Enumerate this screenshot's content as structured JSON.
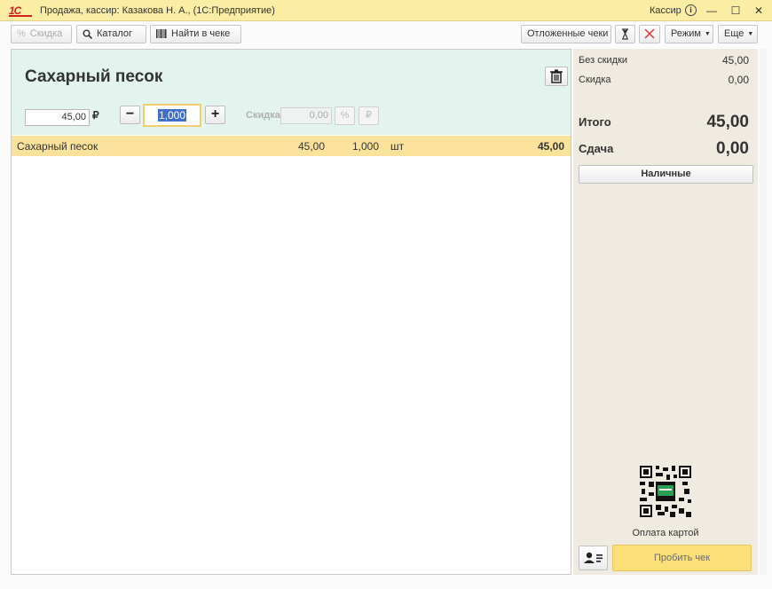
{
  "window": {
    "logo": "1С",
    "title": "Продажа, кассир: Казакова Н. А., (1С:Предприятие)",
    "user": "Кассир",
    "info_icon": "i",
    "minimize": "—",
    "maximize": "☐",
    "close": "✕"
  },
  "toolbar": {
    "discount": "Скидка",
    "catalog": "Каталог",
    "find_in_receipt": "Найти в чеке",
    "deferred_receipts": "Отложенные чеки",
    "mode": "Режим",
    "more": "Еще"
  },
  "product": {
    "name": "Сахарный песок",
    "price": "45,00",
    "currency": "₽",
    "quantity": "1,000",
    "minus": "−",
    "plus": "+",
    "discount_label": "Скидка",
    "discount_value": "0,00",
    "percent_symbol": "%",
    "ruble_symbol": "₽"
  },
  "receipt": {
    "rows": [
      {
        "name": "Сахарный песок",
        "price": "45,00",
        "qty": "1,000",
        "unit": "шт",
        "total": "45,00"
      }
    ]
  },
  "summary": {
    "no_discount_label": "Без скидки",
    "no_discount_value": "45,00",
    "discount_label": "Скидка",
    "discount_value": "0,00",
    "total_label": "Итого",
    "total_value": "45,00",
    "change_label": "Сдача",
    "change_value": "0,00",
    "cash_button": "Наличные",
    "card_payment": "Оплата картой",
    "submit_button": "Пробить чек"
  },
  "colors": {
    "titlebar": "#fbeda4",
    "header_panel": "#e3f4ee",
    "selected_row": "#fbe29a",
    "side_panel": "#efebe1",
    "pay_button": "#fbdf77"
  }
}
